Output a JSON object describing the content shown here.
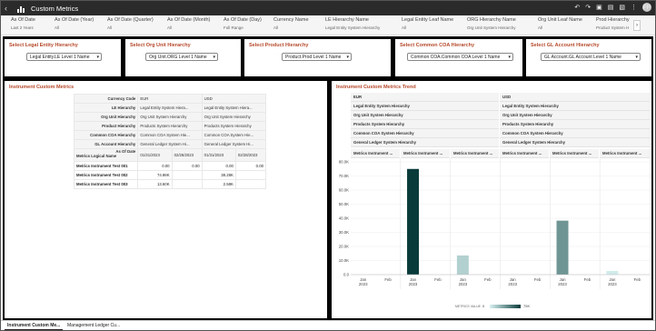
{
  "app": {
    "title": "Custom Metrics"
  },
  "filters": [
    {
      "label": "As Of Date",
      "value": "Last 2 Years"
    },
    {
      "label": "As Of Date (Year)",
      "value": "All"
    },
    {
      "label": "As Of Date (Quarter)",
      "value": "All"
    },
    {
      "label": "As Of Date (Month)",
      "value": "All"
    },
    {
      "label": "As Of Date (Day)",
      "value": "Full Range"
    },
    {
      "label": "Currency Name",
      "value": "All"
    },
    {
      "label": "LE Hierarchy Name",
      "value": "Legal Entity System Hierarchy"
    },
    {
      "label": "Legal Entity Leaf Name",
      "value": "All"
    },
    {
      "label": "ORG Hierarchy Name",
      "value": "Org Unit System Hierarchy"
    },
    {
      "label": "Org Unit Leaf Name",
      "value": "All"
    },
    {
      "label": "Prod Hierarchy",
      "value": "Product System H"
    }
  ],
  "user": {
    "initials": "FP"
  },
  "selectors": [
    {
      "title": "Select Legal Entity Hierarchy",
      "value": "Legal Entity.LE Level 1 Name"
    },
    {
      "title": "Select Org Unit Hierarchy",
      "value": "Org Unit.ORG Level 1 Name"
    },
    {
      "title": "Select Product Hierarchy",
      "value": "Product.Prod Level 1 Name"
    },
    {
      "title": "Select Common COA Hierarchy",
      "value": "Common COA.Common COA Level 1 Name"
    },
    {
      "title": "Select GL Account Hierarchy",
      "value": "GL Account.GL Account Level 1 Name"
    }
  ],
  "metrics_panel": {
    "title": "Instrument Custom Metrics",
    "row_headers": [
      "Currency Code",
      "LE Hierarchy",
      "Org Unit Hierarchy",
      "Product Hierarchy",
      "Common COA Hierarchy",
      "GL Account Hierarchy",
      "As Of Date"
    ],
    "corner_label": "Metrics Logical Name",
    "currencies": [
      "EUR",
      "USD"
    ],
    "le": [
      "Legal Entity System Hiera...",
      "Legal Entity System Hiera..."
    ],
    "org": [
      "Org Unit System Hierarchy",
      "Org Unit System Hierarchy"
    ],
    "prod": [
      "Products System Hierarchy",
      "Products System Hierarchy"
    ],
    "coa": [
      "Common COA System Hie...",
      "Common COA System Hie..."
    ],
    "gl": [
      "General Ledger System Hi...",
      "General Ledger System Hi..."
    ],
    "dates": [
      "01/31/2023",
      "02/28/2023",
      "01/31/2023",
      "02/28/2023"
    ],
    "rows": [
      {
        "name": "Metrics Instrument Test 001",
        "values": [
          "0.00",
          "0.00",
          "0.00",
          "0.00"
        ]
      },
      {
        "name": "Metrics Instrument Test 002",
        "values": [
          "74.98K",
          "",
          "38.28K",
          ""
        ]
      },
      {
        "name": "Metrics Instrument Test 003",
        "values": [
          "13.60K",
          "",
          "2.58K",
          ""
        ]
      }
    ]
  },
  "trend_panel": {
    "title": "Instrument Custom Metrics Trend",
    "headers": {
      "currency": [
        "EUR",
        "USD"
      ],
      "le": [
        "Legal Entity System Hierarchy",
        "Legal Entity System Hierarchy"
      ],
      "org": [
        "Org Unit System Hierarchy",
        "Org Unit System Hierarchy"
      ],
      "prod": [
        "Products System Hierarchy",
        "Products System Hierarchy"
      ],
      "coa": [
        "Common COA System Hierarchy",
        "Common COA System Hierarchy"
      ],
      "gl": [
        "General Ledger System Hierarchy",
        "General Ledger System Hierarchy"
      ],
      "metric": [
        "Metrics Instrument ...",
        "Metrics Instrument ...",
        "Metrics Instrument ...",
        "Metrics Instrument ...",
        "Metrics Instrument ...",
        "Metrics Instrument ..."
      ]
    },
    "legend": {
      "label": "METRICS VALUE",
      "min": "0",
      "max": "75K"
    }
  },
  "chart_data": {
    "type": "bar",
    "ylim": [
      0,
      80000
    ],
    "y_ticks": [
      "0.0",
      "10.0K",
      "20.0K",
      "30.0K",
      "40.0K",
      "50.0K",
      "60.0K",
      "70.0K",
      "80.0K"
    ],
    "x_ticks": [
      {
        "month": "Jan",
        "year": "2023"
      },
      {
        "month": "Feb",
        "year": ""
      }
    ],
    "panels": [
      {
        "currency": "EUR",
        "metric": "Metrics Instrument Test 001",
        "values": [
          0,
          0
        ]
      },
      {
        "currency": "EUR",
        "metric": "Metrics Instrument Test 002",
        "values": [
          74980,
          0
        ]
      },
      {
        "currency": "EUR",
        "metric": "Metrics Instrument Test 003",
        "values": [
          13600,
          0
        ]
      },
      {
        "currency": "USD",
        "metric": "Metrics Instrument Test 001",
        "values": [
          0,
          0
        ]
      },
      {
        "currency": "USD",
        "metric": "Metrics Instrument Test 002",
        "values": [
          38280,
          0
        ]
      },
      {
        "currency": "USD",
        "metric": "Metrics Instrument Test 003",
        "values": [
          2580,
          0
        ]
      }
    ],
    "color_scale": [
      "#d8f1f1",
      "#0a3b3b"
    ]
  },
  "sheet_tabs": [
    "Instrument Custom Me...",
    "Management Ledger Cu..."
  ]
}
